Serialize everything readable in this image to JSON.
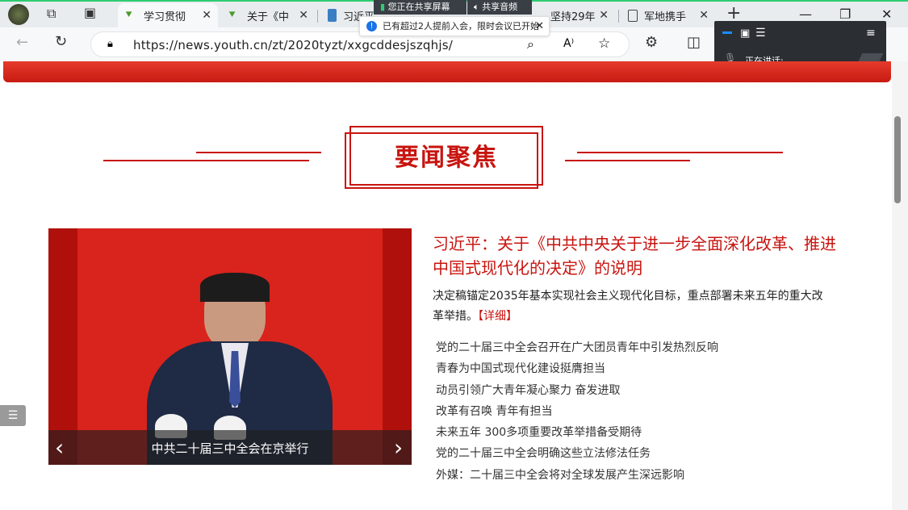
{
  "browser": {
    "tabs": [
      {
        "label": "学习贯彻",
        "active": true
      },
      {
        "label": "关于《中"
      },
      {
        "label": "习近平"
      },
      {
        "label": "坚持29年"
      },
      {
        "label": "军地携手"
      }
    ],
    "new_tab": "+",
    "close_glyph": "✕",
    "url": "https://news.youth.cn/zt/2020tyzt/xxgcddesjszqhjs/",
    "window_controls": {
      "minimize": "—",
      "restore": "❐",
      "close": "✕"
    }
  },
  "meeting": {
    "sharing_screen_label": "您正在共享屏幕",
    "sharing_audio_label": "共享音频中",
    "notice_text": "已有超过2人提前入会，限时会议已开始",
    "speaking_label": "正在讲话:"
  },
  "section": {
    "title": "要闻聚焦"
  },
  "carousel": {
    "caption": "中共二十届三中全会在京举行",
    "prev": "‹",
    "next": "›"
  },
  "feature": {
    "headline": "习近平：关于《中共中央关于进一步全面深化改革、推进中国式现代化的决定》的说明",
    "summary": "决定稿锚定2035年基本实现社会主义现代化目标，重点部署未来五年的重大改革举措。",
    "more_label": "【详细】"
  },
  "news_list": [
    "党的二十届三中全会召开在广大团员青年中引发热烈反响",
    "青春为中国式现代化建设挺膺担当",
    "动员引领广大青年凝心聚力 奋发进取",
    "改革有召唤 青年有担当",
    "未来五年 300多项重要改革举措备受期待",
    "党的二十届三中全会明确这些立法修法任务",
    "外媒：二十届三中全会将对全球发展产生深远影响"
  ],
  "colors": {
    "accent": "#c8140f",
    "browser_chrome": "#e8ecef"
  }
}
